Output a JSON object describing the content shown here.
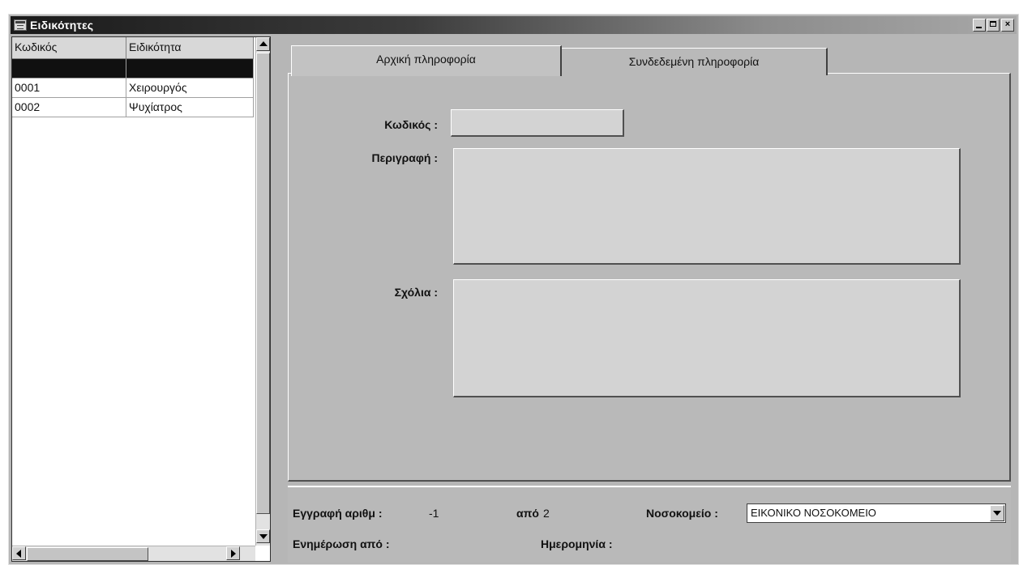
{
  "window": {
    "title": "Ειδικότητες",
    "icon": "app-window-icon",
    "controls": [
      "minimize-icon",
      "maximize-icon",
      "close-icon"
    ],
    "close_glyph": "×"
  },
  "grid": {
    "columns": [
      "Κωδικός",
      "Ειδικότητα"
    ],
    "rows": [
      {
        "code": "",
        "specialty": "",
        "selected": true
      },
      {
        "code": "0001",
        "specialty": "Χειρουργός"
      },
      {
        "code": "0002",
        "specialty": "Ψυχίατρος"
      }
    ]
  },
  "tabs": [
    {
      "label": "Αρχική πληροφορία",
      "active": true
    },
    {
      "label": "Συνδεδεμένη πληροφορία",
      "active": false
    }
  ],
  "form": {
    "code_label": "Κωδικός :",
    "code_value": "",
    "description_label": "Περιγραφή :",
    "description_value": "",
    "comments_label": "Σχόλια :",
    "comments_value": ""
  },
  "status": {
    "record_label": "Εγγραφή αριθμ :",
    "record_value": "-1",
    "of_label": "από",
    "of_value": "2",
    "hospital_label": "Νοσοκομείο :",
    "hospital_value": "ΕΙΚΟΝΙΚΟ ΝΟΣΟΚΟΜΕΙΟ",
    "updated_by_label": "Ενημέρωση από :",
    "date_label": "Ημερομηνία :"
  },
  "colors": {
    "selected_row": "#101010",
    "panel": "#b9b9b9",
    "title_gradient_start": "#1a1a1a"
  }
}
